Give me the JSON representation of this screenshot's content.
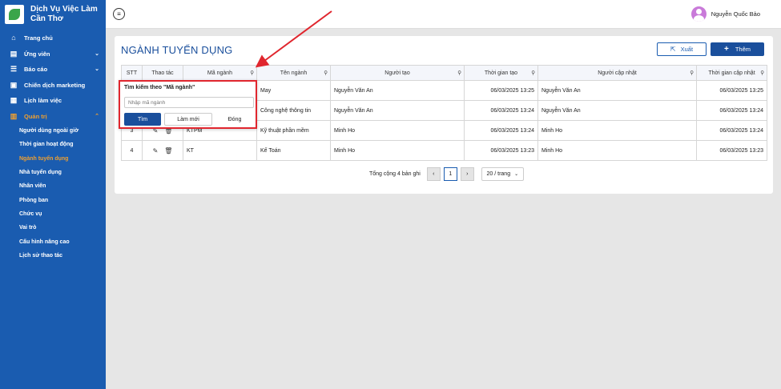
{
  "brand": {
    "title": "Dịch Vụ Việc Làm\nCần Thơ"
  },
  "sidebar": {
    "items": [
      {
        "label": "Trang chủ",
        "icon": "home-icon"
      },
      {
        "label": "Ứng viên",
        "icon": "candidate-icon",
        "expand": true
      },
      {
        "label": "Báo cáo",
        "icon": "list-icon",
        "expand": true
      },
      {
        "label": "Chiến dịch marketing",
        "icon": "campaign-icon"
      },
      {
        "label": "Lịch làm việc",
        "icon": "calendar-icon"
      },
      {
        "label": "Quản trị",
        "icon": "admin-icon",
        "expand": true,
        "active": true
      }
    ],
    "sub_items": [
      {
        "label": "Người dùng ngoài giờ"
      },
      {
        "label": "Thời gian hoạt động"
      },
      {
        "label": "Ngành tuyển dụng",
        "active": true
      },
      {
        "label": "Nhà tuyển dụng"
      },
      {
        "label": "Nhân viên"
      },
      {
        "label": "Phòng ban"
      },
      {
        "label": "Chức vụ"
      },
      {
        "label": "Vai trò"
      },
      {
        "label": "Cấu hình nâng cao"
      },
      {
        "label": "Lịch sử thao tác"
      }
    ]
  },
  "topbar": {
    "user_name": "Nguyễn Quốc Bảo"
  },
  "page": {
    "title": "NGÀNH TUYỂN DỤNG",
    "export_label": "Xuất",
    "add_label": "Thêm"
  },
  "table": {
    "headers": [
      "STT",
      "Thao tác",
      "Mã ngành",
      "Tên ngành",
      "Người tạo",
      "Thời gian tạo",
      "Người cập nhật",
      "Thời gian cập nhật"
    ],
    "rows": [
      {
        "stt": "1",
        "code": "",
        "name": "May",
        "creator": "Nguyễn Văn An",
        "created": "06/03/2025 13:25",
        "updater": "Nguyễn Văn An",
        "updated": "06/03/2025 13:25"
      },
      {
        "stt": "2",
        "code": "",
        "name": "Công nghệ thông tin",
        "creator": "Nguyễn Văn An",
        "created": "06/03/2025 13:24",
        "updater": "Nguyễn Văn An",
        "updated": "06/03/2025 13:24"
      },
      {
        "stt": "3",
        "code": "KTPM",
        "name": "Kỹ thuật phần mềm",
        "creator": "Minh Ho",
        "created": "06/03/2025 13:24",
        "updater": "Minh Ho",
        "updated": "06/03/2025 13:24"
      },
      {
        "stt": "4",
        "code": "KT",
        "name": "Kế Toán",
        "creator": "Minh Ho",
        "created": "06/03/2025 13:23",
        "updater": "Minh Ho",
        "updated": "06/03/2025 13:23"
      }
    ]
  },
  "pagination": {
    "total_text": "Tổng cộng 4 bản ghi",
    "prev": "‹",
    "current_page": "1",
    "next": "›",
    "page_size": "20 / trang"
  },
  "popup": {
    "title": "Tìm kiếm theo \"Mã ngành\"",
    "placeholder": "Nhập mã ngành",
    "search_label": "Tìm",
    "reset_label": "Làm mới",
    "close_label": "Đóng"
  },
  "colors": {
    "sidebar": "#1a5cb0",
    "accent": "#1a4f9c",
    "active": "#f0a030",
    "highlight": "#e0262e"
  }
}
